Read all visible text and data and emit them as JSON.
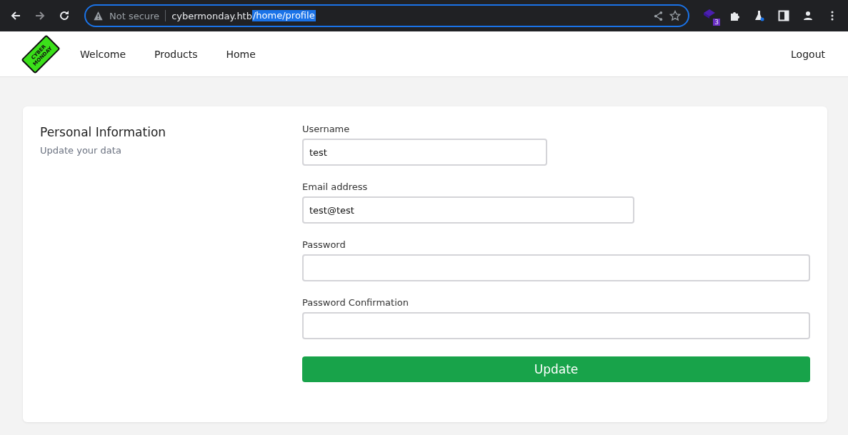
{
  "browser": {
    "security": "Not secure",
    "url_host": "cybermonday.htb",
    "url_path": "/home/profile",
    "path_selected": true,
    "extension_badge": "3"
  },
  "logo": {
    "line_1": "CYBER",
    "line_2": "MONDAY"
  },
  "nav": {
    "links": [
      "Welcome",
      "Products",
      "Home"
    ],
    "logout": "Logout"
  },
  "section": {
    "title": "Personal Information",
    "subtitle": "Update your data"
  },
  "fields": [
    {
      "label": "Username",
      "value": "test",
      "kind": "short"
    },
    {
      "label": "Email address",
      "value": "test@test",
      "kind": "medium"
    },
    {
      "label": "Password",
      "kind": "wide"
    },
    {
      "label": "Password Confirmation",
      "kind": "wide"
    }
  ],
  "submit": "Update"
}
